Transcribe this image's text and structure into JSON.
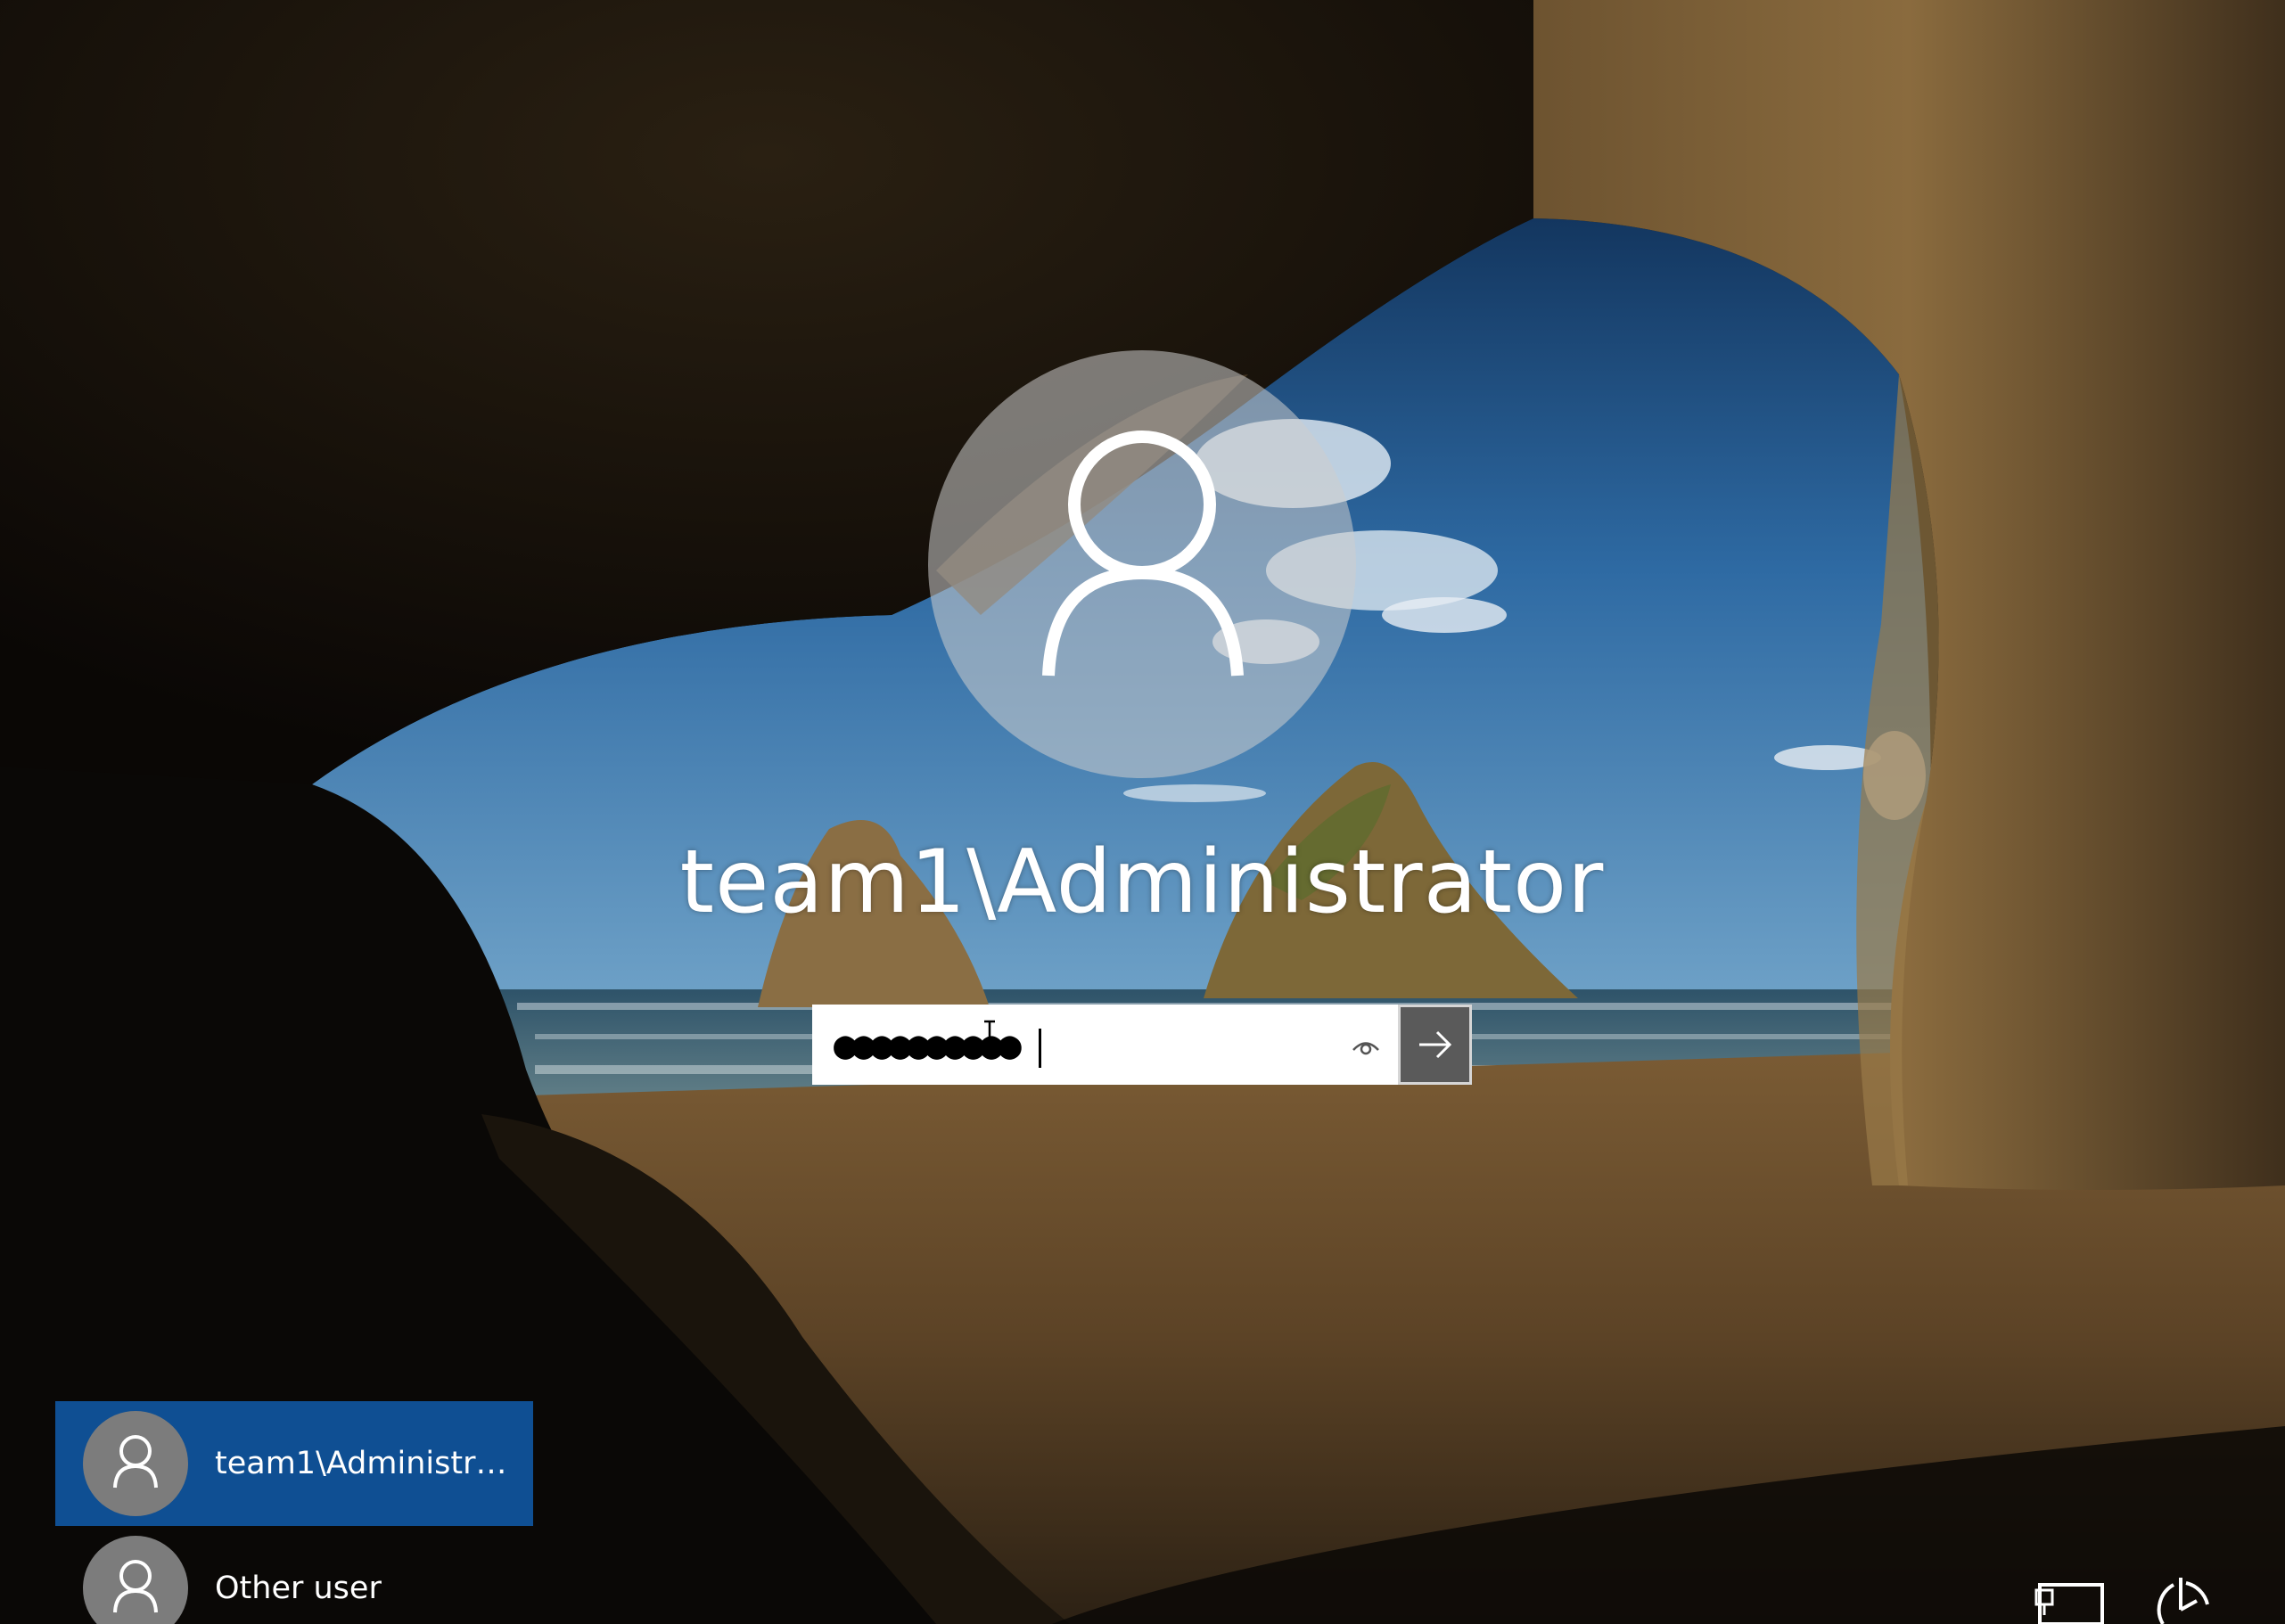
{
  "lock_screen": {
    "account_name": "team1\\Administrator",
    "password_masked": "●●●●●●●●●●"
  },
  "password_field": {
    "reveal_icon": "eye-icon",
    "submit_icon": "arrow-right-icon"
  },
  "user_list": [
    {
      "label": "team1\\Administra...",
      "selected": true,
      "icon": "user-icon"
    },
    {
      "label": "Other user",
      "selected": false,
      "icon": "user-icon"
    }
  ],
  "system_buttons": [
    {
      "icon": "network-icon"
    },
    {
      "icon": "ease-of-access-icon"
    }
  ],
  "colors": {
    "selected_tile": "#0f4f93",
    "submit_button": "#5a5a5a",
    "avatar_circle": "#cdcdcd"
  }
}
